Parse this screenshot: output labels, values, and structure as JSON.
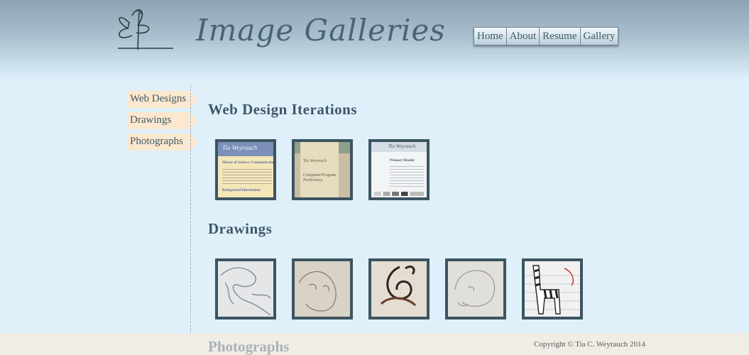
{
  "header": {
    "title": "Image Galleries",
    "logo_icon": "butterfly-sketch-icon"
  },
  "nav": {
    "items": [
      {
        "label": "Home"
      },
      {
        "label": "About"
      },
      {
        "label": "Resume"
      },
      {
        "label": "Gallery"
      }
    ]
  },
  "sidebar": {
    "items": [
      {
        "label": "Web Designs"
      },
      {
        "label": "Drawings"
      },
      {
        "label": "Photographs"
      }
    ]
  },
  "sections": {
    "web": {
      "title": "Web Design Iterations",
      "thumbs": [
        {
          "name": "Tia Weyrauch",
          "subtitle": "Master of Science: Communication",
          "extra": "Background Information"
        },
        {
          "name": "Tia Weyrauch",
          "subtitle": "Computer/Program Proficiency",
          "extra": ""
        },
        {
          "name": "Tia Weyrauch",
          "subtitle": "Primary Header",
          "extra": ""
        }
      ]
    },
    "drawings": {
      "title": "Drawings",
      "thumbs": [
        {
          "subject": "dragon sketch"
        },
        {
          "subject": "cat sketch"
        },
        {
          "subject": "knot sketch"
        },
        {
          "subject": "lion sketch"
        },
        {
          "subject": "zebra sketch"
        }
      ]
    },
    "photographs": {
      "title": "Photographs"
    }
  },
  "footer": {
    "copyright": "Copyright © Tia C. Weyrauch 2014"
  },
  "colors": {
    "header_top": "#8da3b3",
    "background": "#dff0fa",
    "tab_bg": "#fbe8cf",
    "thumb_border": "#3d5461",
    "footer_bg": "#f0ede6"
  }
}
